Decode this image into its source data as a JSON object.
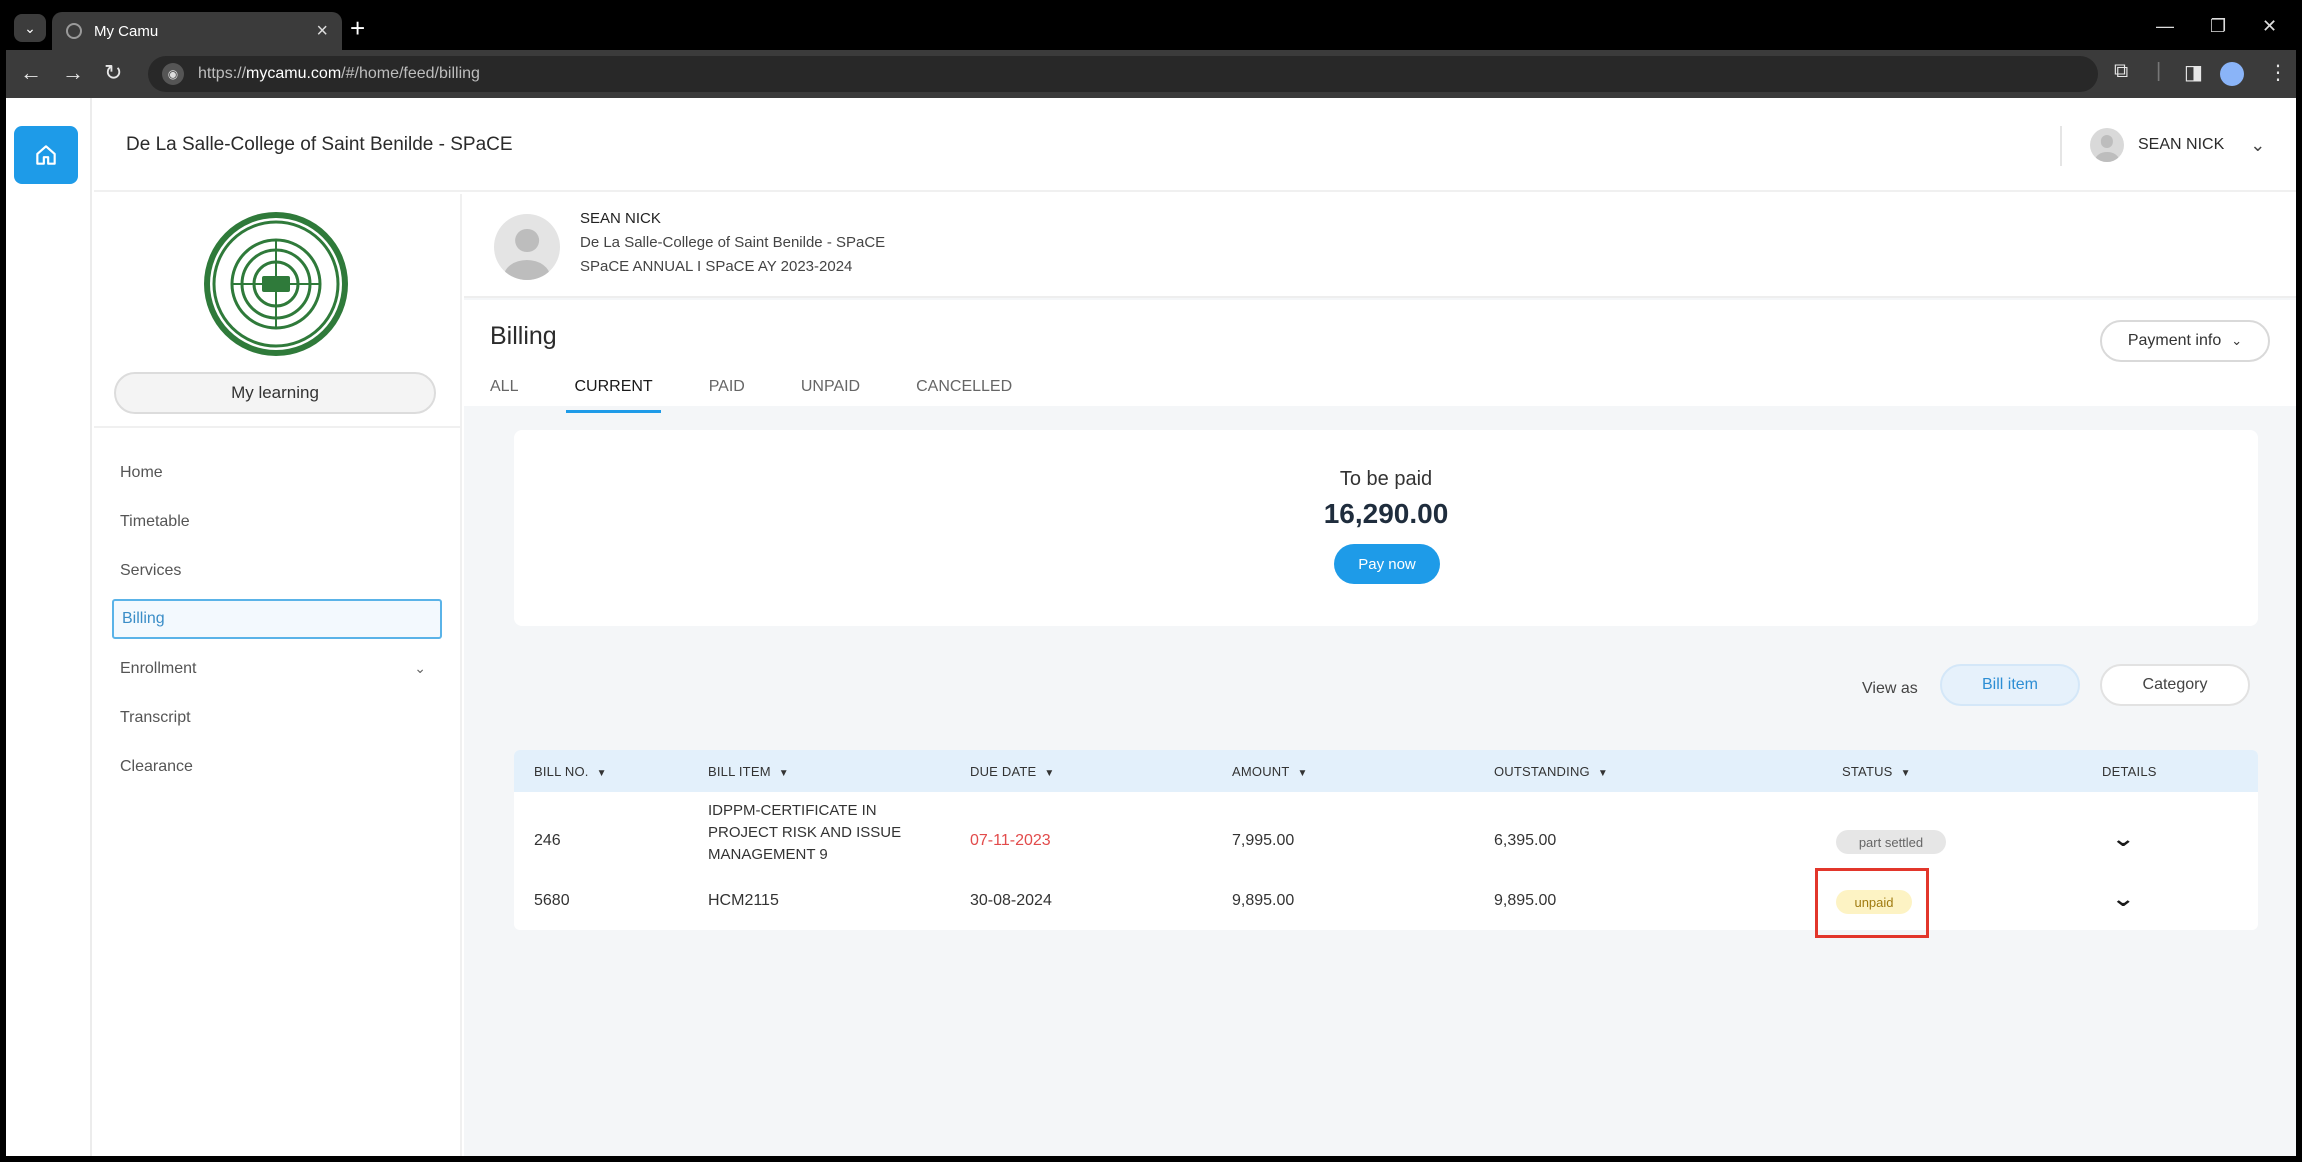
{
  "browser": {
    "tab_title": "My Camu",
    "tab_close": "×",
    "new_tab": "+",
    "url_prefix": "https://",
    "url_domain": "mycamu.com",
    "url_path": "/#/home/feed/billing",
    "icons": [
      "tab-switch-icon",
      "globe-icon",
      "back-icon",
      "forward-icon",
      "reload-icon",
      "site-info-icon",
      "extensions-icon",
      "sidepanel-icon",
      "profile-icon",
      "menu-icon",
      "minimize-icon",
      "restore-icon",
      "close-icon"
    ]
  },
  "header": {
    "college": "De La Salle-College of Saint Benilde - SPaCE",
    "user_name": "SEAN NICK"
  },
  "sidebar": {
    "my_learning": "My learning",
    "items": [
      {
        "label": "Home"
      },
      {
        "label": "Timetable"
      },
      {
        "label": "Services"
      },
      {
        "label": "Billing"
      },
      {
        "label": "Enrollment"
      },
      {
        "label": "Transcript"
      },
      {
        "label": "Clearance"
      }
    ]
  },
  "profile": {
    "name": "SEAN NICK",
    "college": "De La Salle-College of Saint Benilde - SPaCE",
    "program": "SPaCE ANNUAL I SPaCE AY 2023-2024"
  },
  "billing": {
    "title": "Billing",
    "payment_info": "Payment info",
    "tabs": [
      "ALL",
      "CURRENT",
      "PAID",
      "UNPAID",
      "CANCELLED"
    ],
    "active_tab": "CURRENT",
    "to_be_paid_label": "To be paid",
    "to_be_paid_amount": "16,290.00",
    "pay_now": "Pay now",
    "view_as": "View as",
    "view_bill_item": "Bill item",
    "view_category": "Category",
    "columns": [
      "BILL NO.",
      "BILL ITEM",
      "DUE DATE",
      "AMOUNT",
      "OUTSTANDING",
      "STATUS",
      "DETAILS"
    ],
    "rows": [
      {
        "bill_no": "246",
        "item_lines": [
          "IDPPM-CERTIFICATE IN",
          "PROJECT RISK AND ISSUE",
          "MANAGEMENT 9"
        ],
        "due_date": "07-11-2023",
        "amount": "7,995.00",
        "outstanding": "6,395.00",
        "status": "part settled"
      },
      {
        "bill_no": "5680",
        "item_lines": [
          "HCM2115"
        ],
        "due_date": "30-08-2024",
        "amount": "9,895.00",
        "outstanding": "9,895.00",
        "status": "unpaid"
      }
    ],
    "colors": {
      "accent": "#1e9be8",
      "overdue": "#e24b4b",
      "highlight": "#e2362b"
    }
  }
}
